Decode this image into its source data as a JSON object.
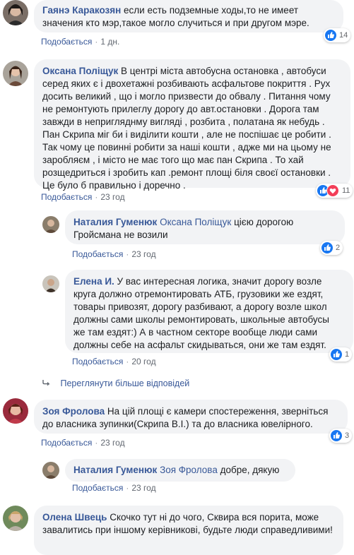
{
  "comments": [
    {
      "author": "Гаянэ Каракозян",
      "text": "если есть подземные ходы,то не имеет значения кто мэр,такое могло случиться и при другом мэре.",
      "like": "Подобається",
      "time": "1 дн.",
      "reactions": "14"
    },
    {
      "author": "Оксана Поліщук",
      "text": "В центрі міста автобусна остановка , автобуси серед яких є і двохетажні розбивають асфальтове покриття . Рух досить великий , що і могло призвести до обвалу . Питання чому не ремонтують прилеглу дорогу до авт.остановки . Дорога там завжди в непригляднму вигляді , розбита , полатана як небудь . Пан Скрипа міг би і виділити кошти , але не поспішає це робити . Так чому це повинні робити за наші кошти , адже ми на цьому не заробляєм , і місто не має того що має пан Скрипа . То хай розщедриться і зробить кап .ремонт площі біля своєї остановки . Це було б правильно і доречно .",
      "like": "Подобається",
      "time": "23 год",
      "reactions": "11"
    },
    {
      "author": "Наталия Гуменюк",
      "mention": "Оксана Поліщук",
      "text": "цією дорогою Гройсмана не возили",
      "like": "Подобається",
      "time": "23 год",
      "reactions": "2"
    },
    {
      "author": "Елена И.",
      "text": "У вас интересная логика, значит дорогу возле круга должно отремонтировать АТБ, грузовики же ездят, товары привозят, дорогу разбивают, а дорогу возле школ должны сами школы ремонтировать, школьные автобусы же там ездят:) А в частном секторе вообще люди сами должны себе на асфальт скидываться, они же там ездят.",
      "like": "Подобається",
      "time": "20 год",
      "reactions": "1"
    },
    {
      "author": "Зоя Фролова",
      "text": "На цій площі є камери спостереження, зверніться до власника зупинки(Скрипа В.І.) та до власника ювелірного.",
      "like": "Подобається",
      "time": "23 год",
      "reactions": "3"
    },
    {
      "author": "Наталия Гуменюк",
      "mention": "Зоя Фролова",
      "text": "добре, дякую",
      "like": "Подобається",
      "time": "23 год"
    },
    {
      "author": "Олена Швець",
      "text": "Скочко тут ні до чого, Сквира вся порита, може завалитись при іншому керівникові, будьте люди справедливими!"
    }
  ],
  "more_replies": "Переглянути більше відповідей",
  "dot": "·",
  "colors": {
    "link": "#385898",
    "bubble": "#f2f3f5",
    "like": "#1877f2",
    "love": "#f33e58"
  },
  "icons": {
    "like": "thumbs-up-icon",
    "love": "heart-icon",
    "reply": "reply-arrow-icon"
  }
}
